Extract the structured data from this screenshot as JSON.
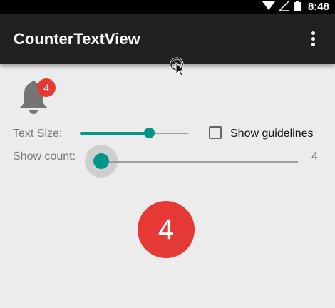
{
  "status_bar": {
    "time": "8:48",
    "icons": [
      "wifi-icon",
      "signal-icon",
      "battery-icon"
    ]
  },
  "app_bar": {
    "title": "CounterTextView",
    "overflow_icon": "more-vert-icon"
  },
  "notification": {
    "icon": "bell-icon",
    "badge_count": "4"
  },
  "controls": {
    "text_size_label": "Text Size:",
    "text_size_level": 0.63,
    "show_guidelines_label": "Show guidelines",
    "show_guidelines_checked": false,
    "show_count_label": "Show count:",
    "show_count_value": "4",
    "show_count_level": 0
  },
  "counter": {
    "value": "4"
  },
  "colors": {
    "accent": "#009688",
    "badge": "#e53935",
    "app_bar": "#212121",
    "background": "#ececec"
  }
}
